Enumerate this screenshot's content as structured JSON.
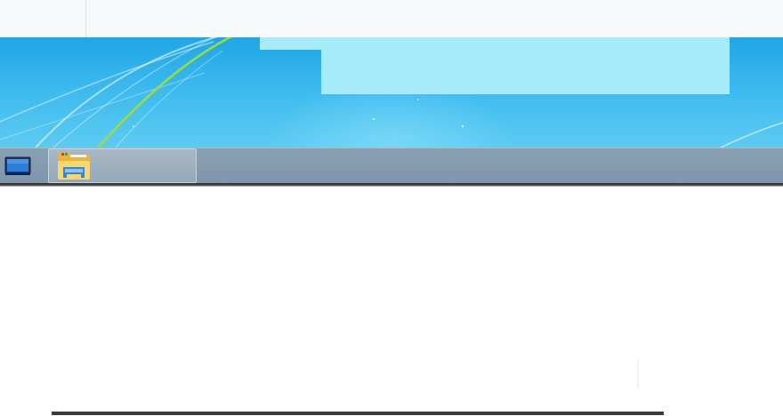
{
  "window": {
    "top_area": "blank"
  },
  "desktop": {
    "wallpaper": "windows-7-blue-swoosh",
    "colors": {
      "wallpaper_top": "#1ea6e6",
      "wallpaper_bottom": "#5ccbf2",
      "highlight": "#a6ebf7",
      "swoosh_green": "#9fdc3a"
    }
  },
  "taskbar": {
    "show_desktop_icon": "monitor-icon",
    "pinned_items": [
      {
        "icon": "windows-explorer-folder-icon",
        "label": ""
      }
    ],
    "colors": {
      "background": "#8aa0b4",
      "button": "#a8b8c6"
    }
  }
}
